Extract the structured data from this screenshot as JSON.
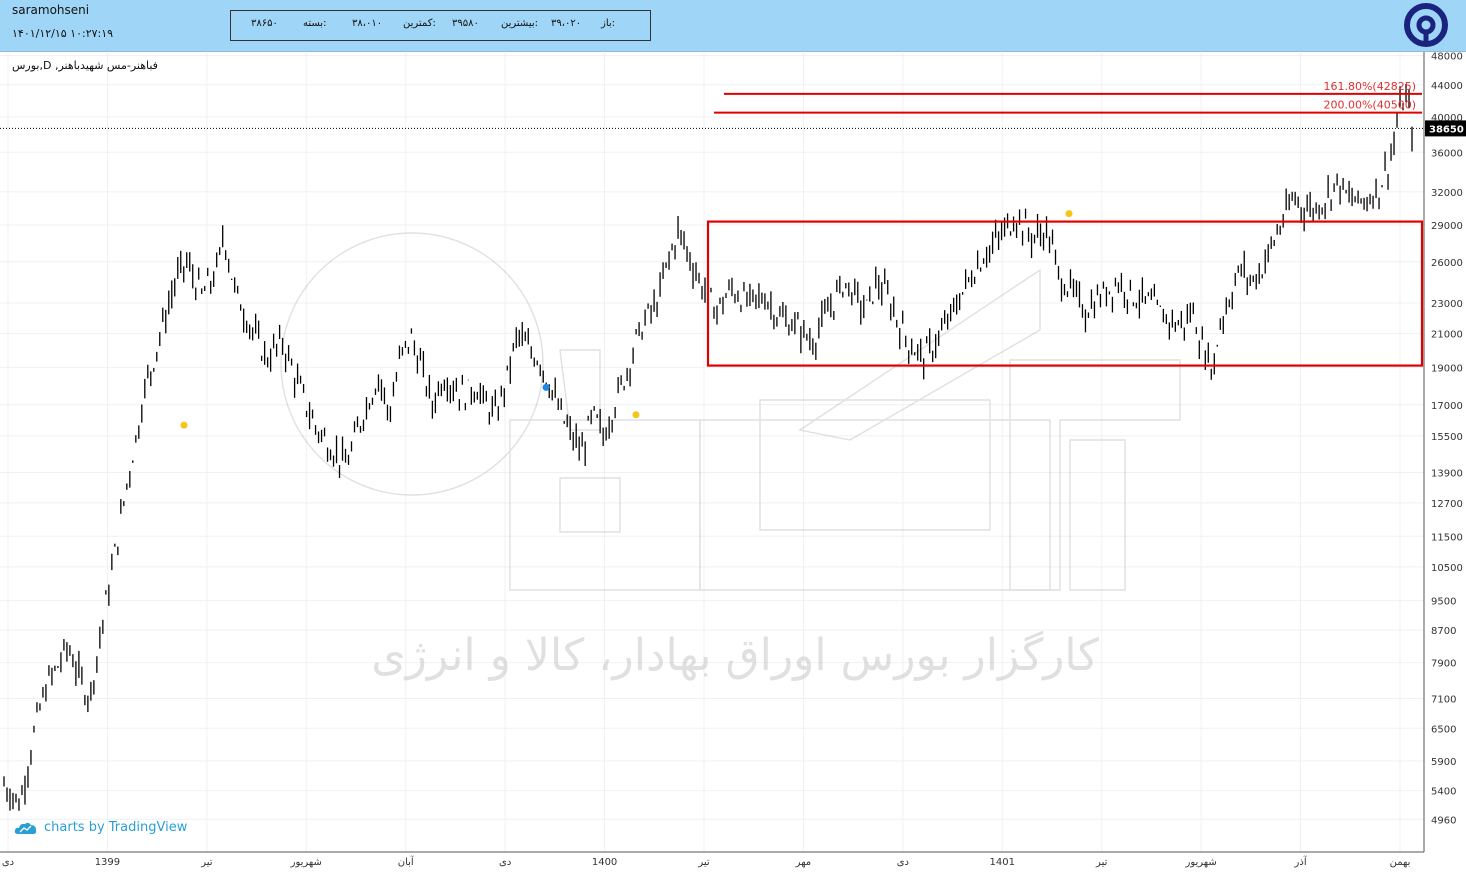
{
  "header": {
    "user": "saramohseni",
    "datetime": "۱۴۰۱/۱۲/۱۵ ۱۰:۲۷:۱۹",
    "open_label": "باز:",
    "open_value": "۳۹،۰۲۰",
    "high_label": "بیشترین:",
    "high_value": "۳۹۵۸۰",
    "low_label": "کمترین:",
    "low_value": "۳۸،۰۱۰",
    "close_label": "بسته:",
    "close_value": "۳۸۶۵۰"
  },
  "symbol_label": "بورس,D ,فباهنر-مس شهیدباهنر",
  "tradingview_credit": "charts by TradingView",
  "watermark_text": "کارگزار بورس اوراق بهادار، کالا و انرژی",
  "colors": {
    "header_bg": "#9fd6f7",
    "candle": "#000000",
    "rectangle": "#e00000",
    "fib_line": "#e00000",
    "fib_text": "#e03030",
    "marker_yellow": "#f5c518",
    "marker_blue": "#1e88e5",
    "price_tag_bg": "#000000",
    "credit": "#2a9fd6",
    "logo": "#1a237e"
  },
  "chart_data": {
    "type": "candlestick",
    "y_scale": "log",
    "ylim": [
      4500,
      48500
    ],
    "y_ticks": [
      48000,
      44000,
      40000,
      36000,
      32000,
      29000,
      26000,
      23000,
      21000,
      19000,
      17000,
      15500,
      13900,
      12700,
      11500,
      10500,
      9500,
      8700,
      7900,
      7100,
      6500,
      5900,
      5400,
      4960
    ],
    "current_price": 38650,
    "x_labels": [
      "دی",
      "1399",
      "تیر",
      "شهریور",
      "آبان",
      "دی",
      "1400",
      "تیر",
      "مهر",
      "دی",
      "1401",
      "تیر",
      "شهریور",
      "آذر",
      "بهمن"
    ],
    "price_path": [
      [
        0,
        5500
      ],
      [
        3,
        5200
      ],
      [
        6,
        6600
      ],
      [
        8,
        7400
      ],
      [
        10,
        7800
      ],
      [
        12,
        8300
      ],
      [
        14,
        7600
      ],
      [
        16,
        7100
      ],
      [
        19,
        9400
      ],
      [
        21,
        11200
      ],
      [
        23,
        13500
      ],
      [
        25,
        15800
      ],
      [
        26,
        17500
      ],
      [
        28,
        19500
      ],
      [
        30,
        22000
      ],
      [
        32,
        24500
      ],
      [
        34,
        26000
      ],
      [
        37,
        23500
      ],
      [
        40,
        25500
      ],
      [
        41,
        28500
      ],
      [
        43,
        24000
      ],
      [
        46,
        21500
      ],
      [
        49,
        19500
      ],
      [
        52,
        20500
      ],
      [
        55,
        18000
      ],
      [
        58,
        16000
      ],
      [
        61,
        15000
      ],
      [
        64,
        14200
      ],
      [
        67,
        16500
      ],
      [
        70,
        18500
      ],
      [
        72,
        16500
      ],
      [
        74,
        19500
      ],
      [
        76,
        20800
      ],
      [
        78,
        19000
      ],
      [
        80,
        17000
      ],
      [
        82,
        18500
      ],
      [
        84,
        18000
      ],
      [
        86,
        17500
      ],
      [
        88,
        18000
      ],
      [
        90,
        17000
      ],
      [
        92,
        16500
      ],
      [
        94,
        18500
      ],
      [
        96,
        21000
      ],
      [
        98,
        20000
      ],
      [
        100,
        19500
      ],
      [
        102,
        18000
      ],
      [
        104,
        16500
      ],
      [
        106,
        15500
      ],
      [
        108,
        14800
      ],
      [
        110,
        16500
      ],
      [
        112,
        15500
      ],
      [
        114,
        17000
      ],
      [
        116,
        18500
      ],
      [
        118,
        20500
      ],
      [
        120,
        22000
      ],
      [
        122,
        23000
      ],
      [
        124,
        26000
      ],
      [
        126,
        28500
      ],
      [
        127,
        27500
      ],
      [
        130,
        24500
      ],
      [
        133,
        22500
      ],
      [
        136,
        24000
      ],
      [
        139,
        23000
      ],
      [
        142,
        23500
      ],
      [
        145,
        22000
      ],
      [
        148,
        21500
      ],
      [
        151,
        20500
      ],
      [
        154,
        22500
      ],
      [
        157,
        24500
      ],
      [
        159,
        23500
      ],
      [
        161,
        22500
      ],
      [
        163,
        24500
      ],
      [
        165,
        23500
      ],
      [
        168,
        21000
      ],
      [
        170,
        20000
      ],
      [
        172,
        19600
      ],
      [
        174,
        20500
      ],
      [
        176,
        21500
      ],
      [
        178,
        23000
      ],
      [
        180,
        24500
      ],
      [
        183,
        26500
      ],
      [
        186,
        28000
      ],
      [
        189,
        29800
      ],
      [
        192,
        28000
      ],
      [
        195,
        28500
      ],
      [
        197,
        25000
      ],
      [
        199,
        24000
      ],
      [
        202,
        22500
      ],
      [
        205,
        23500
      ],
      [
        208,
        24500
      ],
      [
        211,
        23500
      ],
      [
        214,
        23000
      ],
      [
        217,
        22000
      ],
      [
        220,
        21500
      ],
      [
        222,
        22500
      ],
      [
        224,
        20000
      ],
      [
        226,
        19000
      ],
      [
        227,
        21500
      ],
      [
        229,
        23500
      ],
      [
        231,
        25500
      ],
      [
        233,
        24500
      ],
      [
        235,
        25500
      ],
      [
        237,
        27500
      ],
      [
        239,
        29500
      ],
      [
        241,
        31500
      ],
      [
        243,
        30500
      ],
      [
        245,
        30500
      ],
      [
        247,
        31500
      ],
      [
        249,
        33000
      ],
      [
        251,
        31500
      ],
      [
        253,
        31000
      ],
      [
        255,
        31500
      ],
      [
        257,
        32500
      ],
      [
        259,
        35500
      ],
      [
        261,
        41500
      ],
      [
        262,
        42500
      ],
      [
        263,
        38650
      ]
    ],
    "markers": [
      {
        "price": 16000,
        "color": "yellow"
      },
      {
        "price": 17900,
        "color": "blue"
      },
      {
        "price": 16500,
        "color": "yellow"
      },
      {
        "price": 30000,
        "color": "yellow"
      }
    ],
    "range_box": {
      "low": 19100,
      "high": 29300
    },
    "fib_levels": [
      {
        "label": "161.80%(42825)",
        "price": 42825
      },
      {
        "label": "200.00%(40500)",
        "price": 40500
      }
    ]
  }
}
